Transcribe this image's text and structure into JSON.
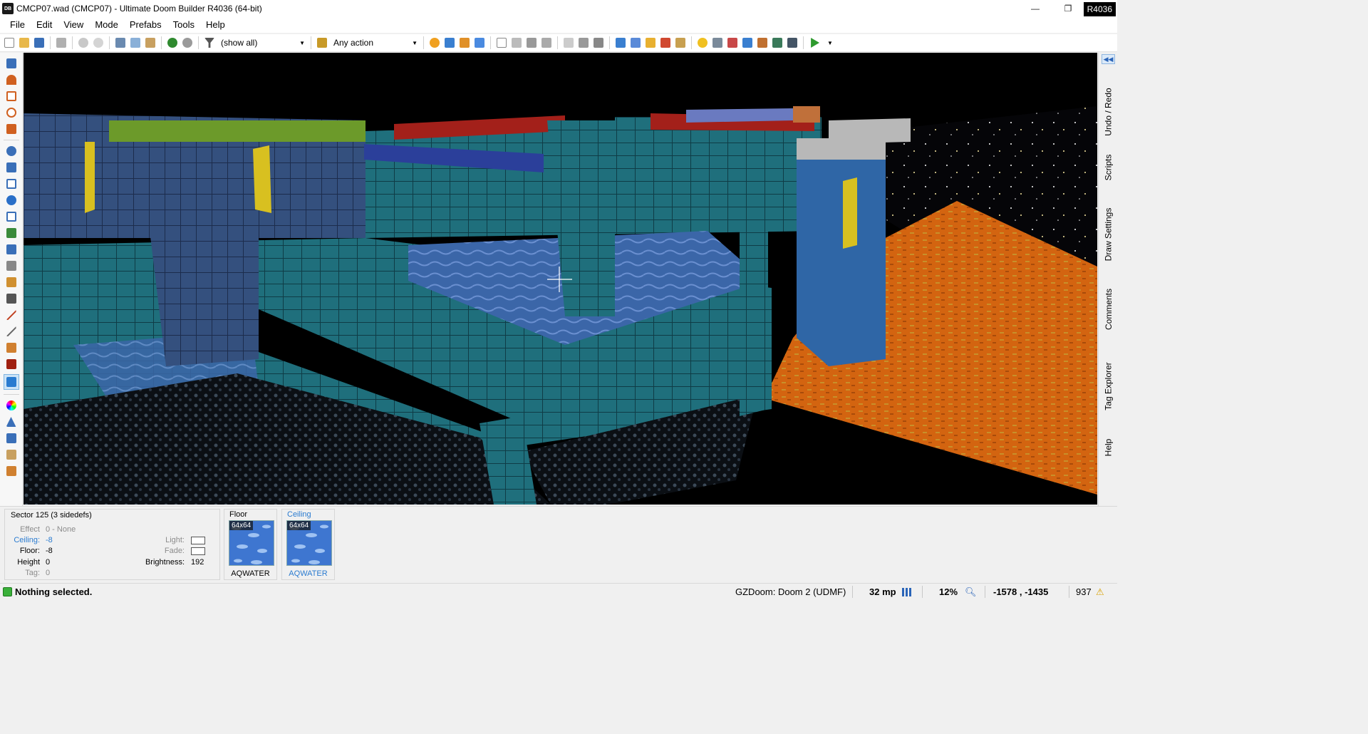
{
  "window": {
    "app_icon": "DB",
    "title": "CMCP07.wad (CMCP07) - Ultimate Doom Builder R4036 (64-bit)",
    "revision_badge": "R4036",
    "controls": [
      "—",
      "❐",
      "✕"
    ]
  },
  "menu": [
    "File",
    "Edit",
    "View",
    "Mode",
    "Prefabs",
    "Tools",
    "Help"
  ],
  "toolbar": {
    "filter_value": "(show all)",
    "action_value": "Any action",
    "icons": [
      "new-map-icon",
      "open-map-icon",
      "save-map-icon",
      "map-options-icon",
      "undo-icon",
      "redo-icon",
      "cut-icon",
      "copy-icon",
      "paste-icon",
      "insert-prefab-icon",
      "insert-prefab-file-icon",
      "things-filter-icon",
      "linedef-action-icon",
      "brightness-icon",
      "grid-icon",
      "texture-preview-icon",
      "camera-icon",
      "view-normal-icon",
      "view-brightness-icon",
      "view-floor-icon",
      "view-ceiling-icon",
      "textured-icon",
      "grid-toggle-icon",
      "models-icon",
      "lights-icon",
      "fog-icon",
      "dynamic-light-icon",
      "screenshot-icon",
      "fullbright-icon",
      "sky-icon",
      "highlight-icon",
      "info-icon",
      "test-map-icon"
    ]
  },
  "left_tools": [
    "draw-lines-icon",
    "draw-curve-icon",
    "draw-rectangle-icon",
    "draw-ellipse-icon",
    "draw-grid-icon",
    "vertices-mode-icon",
    "linedefs-mode-icon",
    "sectors-mode-icon",
    "things-mode-icon",
    "make-sector-icon",
    "sound-propagation-icon",
    "sound-environment-icon",
    "image-icon",
    "sector-list-icon",
    "floor-slope-icon",
    "ceiling-slope-icon",
    "sector-brightness-icon",
    "visplane-explorer-icon",
    "visual-mode-icon",
    "color-picker-icon",
    "terrain-icon",
    "snap-icon",
    "bridge-icon",
    "stair-builder-icon"
  ],
  "colors": {
    "accent_blue": "#2a7bd0",
    "status_green": "#3ab03a",
    "lava": "#d96a14",
    "teal_floor": "#1c6e7a"
  },
  "dock_tabs": [
    "Undo / Redo",
    "Scripts",
    "Draw Settings",
    "Comments",
    "Tag Explorer",
    "Help"
  ],
  "info": {
    "sector_title": "Sector 125 (3 sidedefs)",
    "effect": {
      "label": "Effect",
      "value": "0 - None"
    },
    "ceiling": {
      "label": "Ceiling:",
      "value": "-8"
    },
    "floor": {
      "label": "Floor:",
      "value": "-8"
    },
    "height": {
      "label": "Height",
      "value": "0"
    },
    "tag": {
      "label": "Tag:",
      "value": "0"
    },
    "light": {
      "label": "Light:"
    },
    "fade": {
      "label": "Fade:"
    },
    "brightness": {
      "label": "Brightness:",
      "value": "192"
    },
    "floor_texture": {
      "heading": "Floor",
      "size": "64x64",
      "name": "AQWATER"
    },
    "ceiling_texture": {
      "heading": "Ceiling",
      "size": "64x64",
      "name": "AQWATER"
    }
  },
  "status": {
    "message": "Nothing selected.",
    "engine": "GZDoom: Doom 2 (UDMF)",
    "grid_size": "32 mp",
    "zoom": "12%",
    "coordinates": "-1578 , -1435",
    "count": "937"
  }
}
